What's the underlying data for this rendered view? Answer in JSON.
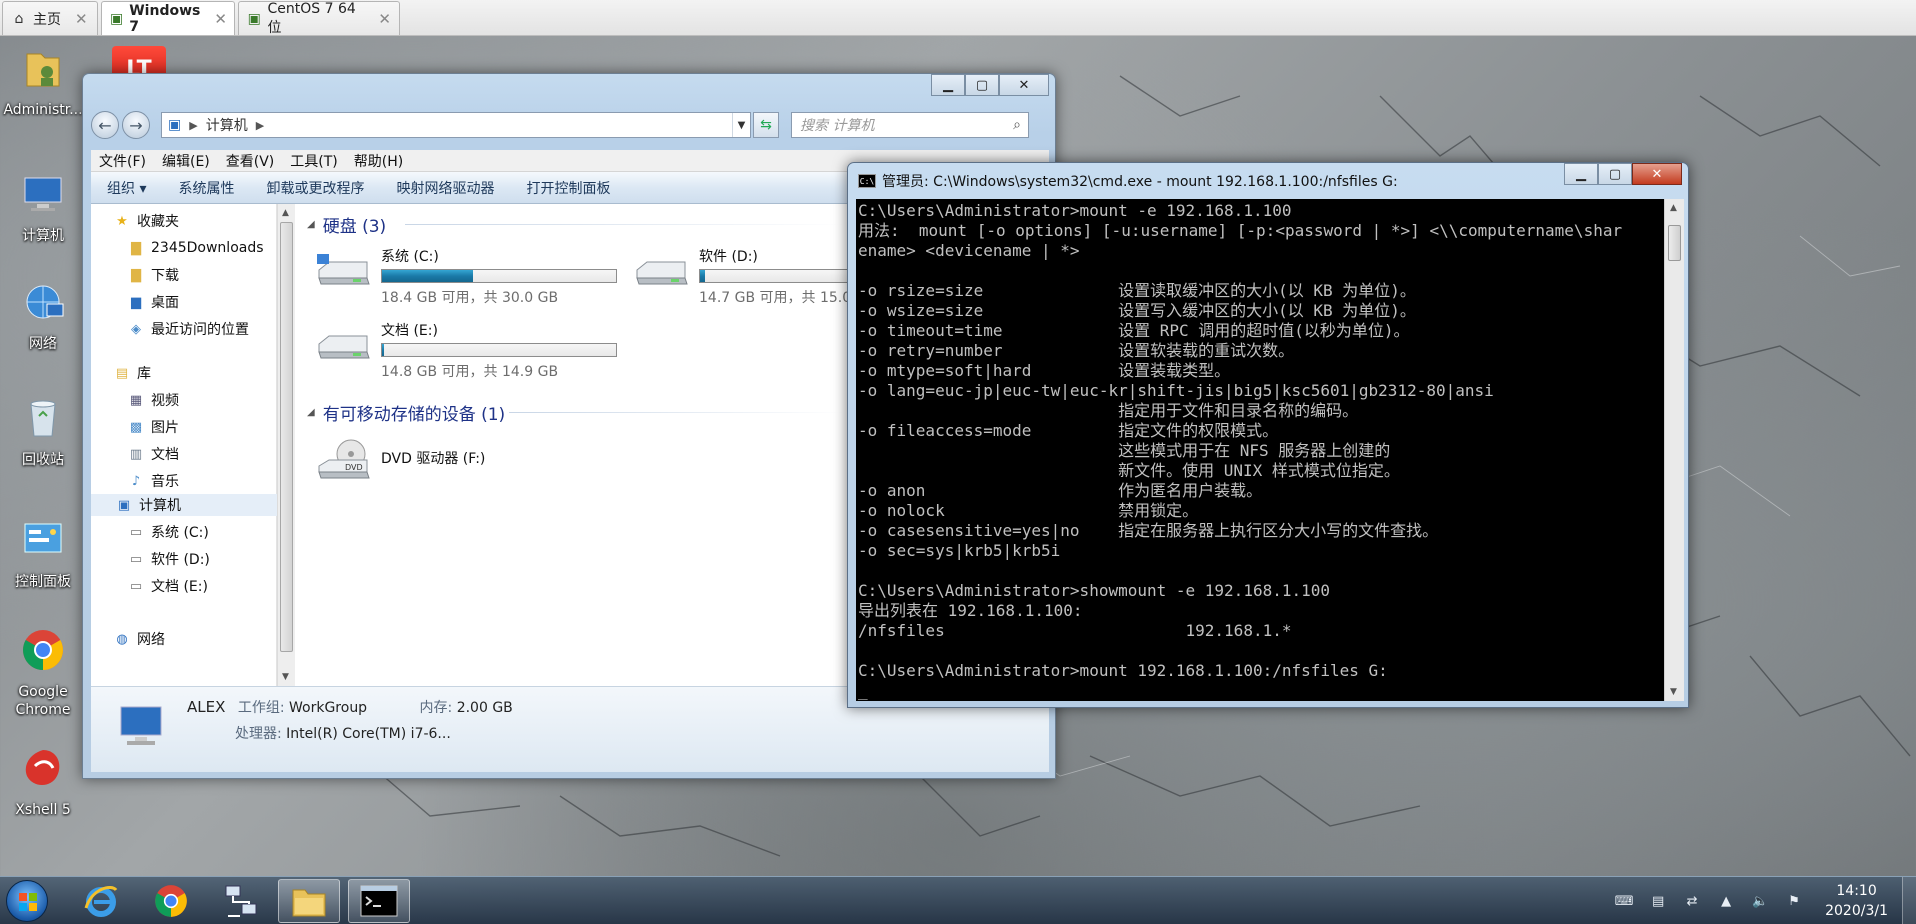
{
  "vm_tabs": [
    {
      "label": "主页",
      "icon": "home-icon"
    },
    {
      "label": "Windows 7",
      "icon": "vm-icon"
    },
    {
      "label": "CentOS 7 64 位",
      "icon": "vm-icon"
    }
  ],
  "desktop_icons": [
    {
      "label": "Administr...",
      "icon": "user-folder-icon"
    },
    {
      "label": "计算机",
      "icon": "computer-icon"
    },
    {
      "label": "网络",
      "icon": "network-icon"
    },
    {
      "label": "回收站",
      "icon": "recycle-bin-icon"
    },
    {
      "label": "控制面板",
      "icon": "control-panel-icon"
    },
    {
      "label": "Google Chrome",
      "icon": "chrome-icon"
    },
    {
      "label": "Xshell 5",
      "icon": "xshell-icon"
    }
  ],
  "explorer": {
    "address_path": "计算机",
    "search_placeholder": "搜索 计算机",
    "menu": [
      "文件(F)",
      "编辑(E)",
      "查看(V)",
      "工具(T)",
      "帮助(H)"
    ],
    "commands": [
      "组织 ▾",
      "系统属性",
      "卸载或更改程序",
      "映射网络驱动器",
      "打开控制面板"
    ],
    "nav": {
      "favorites": "收藏夹",
      "fav_items": [
        "2345Downloads",
        "下载",
        "桌面",
        "最近访问的位置"
      ],
      "libraries": "库",
      "lib_items": [
        "视频",
        "图片",
        "文档",
        "音乐"
      ],
      "computer": "计算机",
      "comp_items": [
        "系统 (C:)",
        "软件 (D:)",
        "文档 (E:)"
      ],
      "network": "网络"
    },
    "groups": {
      "hard_disks": "硬盘 (3)",
      "removable": "有可移动存储的设备 (1)"
    },
    "drives": [
      {
        "name": "系统 (C:)",
        "free": "18.4 GB 可用，共 30.0 GB",
        "used_fraction": 0.39
      },
      {
        "name": "软件 (D:)",
        "free": "14.7 GB 可用，共 15.0",
        "used_fraction": 0.02
      },
      {
        "name": "文档 (E:)",
        "free": "14.8 GB 可用，共 14.9 GB",
        "used_fraction": 0.01
      }
    ],
    "dvd": {
      "name": "DVD 驱动器 (F:)",
      "badge": "DVD"
    },
    "details": {
      "name": "ALEX",
      "workgroup_label": "工作组:",
      "workgroup": "WorkGroup",
      "memory_label": "内存:",
      "memory": "2.00 GB",
      "cpu_label": "处理器:",
      "cpu": "Intel(R) Core(TM) i7-6..."
    }
  },
  "cmd": {
    "title": "管理员: C:\\Windows\\system32\\cmd.exe - mount  192.168.1.100:/nfsfiles G:",
    "icon_text": "C:\\",
    "lines": [
      "C:\\Users\\Administrator>mount -e 192.168.1.100",
      "用法:  mount [-o options] [-u:username] [-p:<password | *>] <\\\\computername\\shar",
      "ename> <devicename | *>",
      "",
      "-o rsize=size              设置读取缓冲区的大小(以 KB 为单位)。",
      "-o wsize=size              设置写入缓冲区的大小(以 KB 为单位)。",
      "-o timeout=time            设置 RPC 调用的超时值(以秒为单位)。",
      "-o retry=number            设置软装载的重试次数。",
      "-o mtype=soft|hard         设置装载类型。",
      "-o lang=euc-jp|euc-tw|euc-kr|shift-jis|big5|ksc5601|gb2312-80|ansi",
      "                           指定用于文件和目录名称的编码。",
      "-o fileaccess=mode         指定文件的权限模式。",
      "                           这些模式用于在 NFS 服务器上创建的",
      "                           新文件。使用 UNIX 样式模式位指定。",
      "-o anon                    作为匿名用户装载。",
      "-o nolock                  禁用锁定。",
      "-o casesensitive=yes|no    指定在服务器上执行区分大小写的文件查找。",
      "-o sec=sys|krb5|krb5i",
      "",
      "C:\\Users\\Administrator>showmount -e 192.168.1.100",
      "导出列表在 192.168.1.100:",
      "/nfsfiles                         192.168.1.*",
      "",
      "C:\\Users\\Administrator>mount 192.168.1.100:/nfsfiles G:",
      "_"
    ]
  },
  "taskbar": {
    "apps": [
      "start-orb",
      "ie-icon",
      "chrome-icon",
      "network-tool-icon",
      "explorer-icon",
      "cmd-icon"
    ],
    "time": "14:10",
    "date": "2020/3/1"
  }
}
